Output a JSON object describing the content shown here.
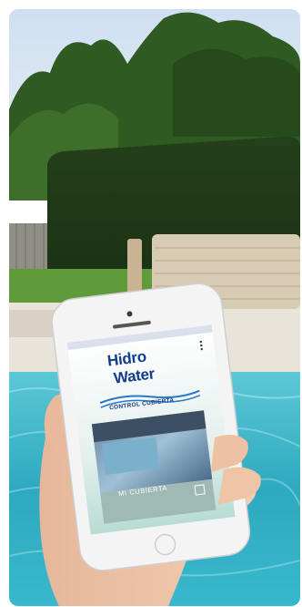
{
  "app": {
    "brand_line1": "Hidro",
    "brand_line2": "Water",
    "screen_title": "CONTROL CUBIERTA",
    "card_label": "MI CUBIERTA"
  },
  "icons": {
    "menu": "kebab-menu-icon",
    "card_action": "plus-icon"
  },
  "colors": {
    "brand_blue": "#123e8c",
    "pool_water": "#3fb3c4",
    "phone_body": "#f4f4f4"
  }
}
